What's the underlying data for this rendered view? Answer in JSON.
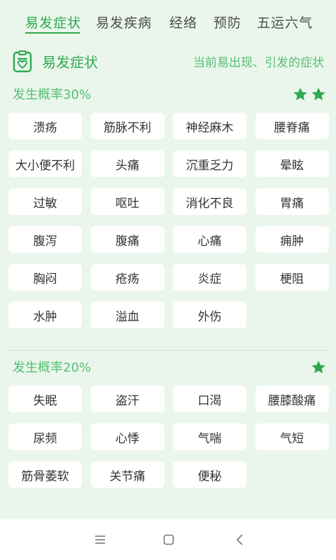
{
  "tabs": [
    {
      "label": "易发症状",
      "active": true
    },
    {
      "label": "易发疾病",
      "active": false
    },
    {
      "label": "经络",
      "active": false
    },
    {
      "label": "预防",
      "active": false
    },
    {
      "label": "五运六气",
      "active": false
    }
  ],
  "header": {
    "icon": "clipboard-heart-icon",
    "title": "易发症状",
    "subtitle": "当前易出现、引发的症状"
  },
  "groups": [
    {
      "label": "发生概率30%",
      "stars": 2,
      "items": [
        "溃疡",
        "筋脉不利",
        "神经麻木",
        "腰脊痛",
        "大小便不利",
        "头痛",
        "沉重乏力",
        "晕眩",
        "过敏",
        "呕吐",
        "消化不良",
        "胃痛",
        "腹泻",
        "腹痛",
        "心痛",
        "痈肿",
        "胸闷",
        "疮疡",
        "炎症",
        "梗阻",
        "水肿",
        "溢血",
        "外伤"
      ]
    },
    {
      "label": "发生概率20%",
      "stars": 1,
      "items": [
        "失眠",
        "盗汗",
        "口渴",
        "腰膝酸痛",
        "尿频",
        "心悸",
        "气喘",
        "气短",
        "筋骨萎软",
        "关节痛",
        "便秘"
      ]
    }
  ],
  "colors": {
    "accent": "#2fa84f",
    "accent_light": "#55bf72",
    "background": "#eaf6ec",
    "chip": "#ffffff"
  },
  "navbar": {
    "icons": [
      "menu-icon",
      "home-square-icon",
      "back-chevron-icon"
    ]
  }
}
